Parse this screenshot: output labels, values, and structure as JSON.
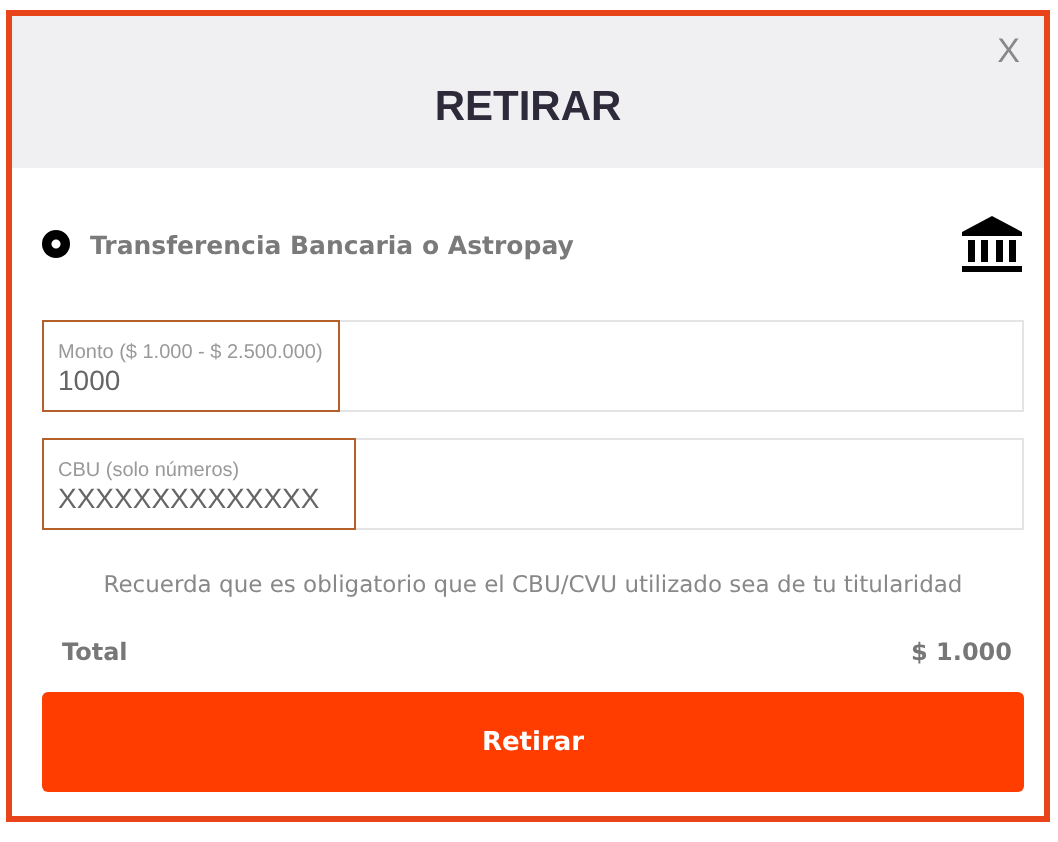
{
  "dialog": {
    "title": "RETIRAR",
    "close": "X"
  },
  "method": {
    "label": "Transferencia Bancaria o Astropay",
    "selected": true
  },
  "fields": [
    {
      "label": "Monto ($ 1.000 - $ 2.500.000)",
      "value": "1000",
      "highlighted": true
    },
    {
      "label": "CBU (solo números)",
      "value": "XXXXXXXXXXXXXX",
      "highlighted": true
    }
  ],
  "notice": "Recuerda que es obligatorio que el CBU/CVU utilizado sea de tu titularidad",
  "total": {
    "label": "Total",
    "amount": "$ 1.000"
  },
  "button": "Retirar"
}
